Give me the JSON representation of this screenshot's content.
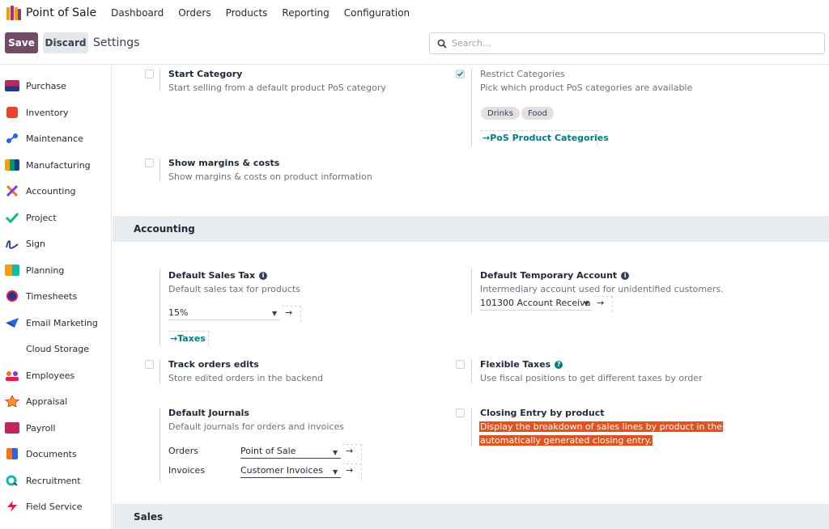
{
  "app": {
    "title": "Point of Sale"
  },
  "nav": [
    "Dashboard",
    "Orders",
    "Products",
    "Reporting",
    "Configuration"
  ],
  "toolbar": {
    "save": "Save",
    "discard": "Discard",
    "breadcrumb": "Settings"
  },
  "search": {
    "placeholder": "Search..."
  },
  "sidebar": {
    "items": [
      {
        "label": "Purchase",
        "icon": "purchase-icon",
        "color": "#c0255e"
      },
      {
        "label": "Inventory",
        "icon": "inventory-icon",
        "color": "#e8452f"
      },
      {
        "label": "Maintenance",
        "icon": "maintenance-icon",
        "color": "#2563eb"
      },
      {
        "label": "Manufacturing",
        "icon": "manufacturing-icon",
        "color": "#f59e0b"
      },
      {
        "label": "Accounting",
        "icon": "accounting-icon",
        "color": "#f97316"
      },
      {
        "label": "Project",
        "icon": "project-icon",
        "color": "#10b981"
      },
      {
        "label": "Sign",
        "icon": "sign-icon",
        "color": "#1e3a8a"
      },
      {
        "label": "Planning",
        "icon": "planning-icon",
        "color": "#f59e0b"
      },
      {
        "label": "Timesheets",
        "icon": "timesheets-icon",
        "color": "#1e3a8a"
      },
      {
        "label": "Email Marketing",
        "icon": "email-marketing-icon",
        "color": "#2563eb"
      },
      {
        "label": "Cloud Storage",
        "icon": "cloud-storage-icon",
        "color": "#ffffff"
      },
      {
        "label": "Employees",
        "icon": "employees-icon",
        "color": "#f97316"
      },
      {
        "label": "Appraisal",
        "icon": "appraisal-icon",
        "color": "#e11d48"
      },
      {
        "label": "Payroll",
        "icon": "payroll-icon",
        "color": "#c0255e"
      },
      {
        "label": "Documents",
        "icon": "documents-icon",
        "color": "#f97316"
      },
      {
        "label": "Recruitment",
        "icon": "recruitment-icon",
        "color": "#14b8a6"
      },
      {
        "label": "Field Service",
        "icon": "field-service-icon",
        "color": "#e11d48"
      }
    ]
  },
  "pos": {
    "start_category": {
      "title": "Start Category",
      "desc": "Start selling from a default product PoS category"
    },
    "restrict_categories": {
      "title": "Restrict Categories",
      "desc": "Pick which product PoS categories are available",
      "tags": [
        "Drinks",
        "Food"
      ],
      "link": "PoS Product Categories"
    },
    "margins": {
      "title": "Show margins & costs",
      "desc": "Show margins & costs on product information"
    }
  },
  "accounting": {
    "header": "Accounting",
    "sales_tax": {
      "title": "Default Sales Tax",
      "desc": "Default sales tax for products",
      "value": "15%",
      "link": "Taxes"
    },
    "temp_account": {
      "title": "Default Temporary Account",
      "desc": "Intermediary account used for unidentified customers.",
      "value": "101300 Account Receiva"
    },
    "track_edits": {
      "title": "Track orders edits",
      "desc": "Store edited orders in the backend"
    },
    "flexible_taxes": {
      "title": "Flexible Taxes",
      "desc": "Use fiscal positions to get different taxes by order"
    },
    "journals": {
      "title": "Default Journals",
      "desc": "Default journals for orders and invoices",
      "orders_label": "Orders",
      "orders_value": "Point of Sale",
      "invoices_label": "Invoices",
      "invoices_value": "Customer Invoices"
    },
    "closing_entry": {
      "title": "Closing Entry by product",
      "desc_line1": "Display the breakdown of sales lines by product in the",
      "desc_line2": "automatically generated closing entry."
    }
  },
  "sales": {
    "header": "Sales"
  },
  "colors": {
    "primary": "#714b67",
    "link": "#017e84",
    "highlight": "#e0531e"
  }
}
